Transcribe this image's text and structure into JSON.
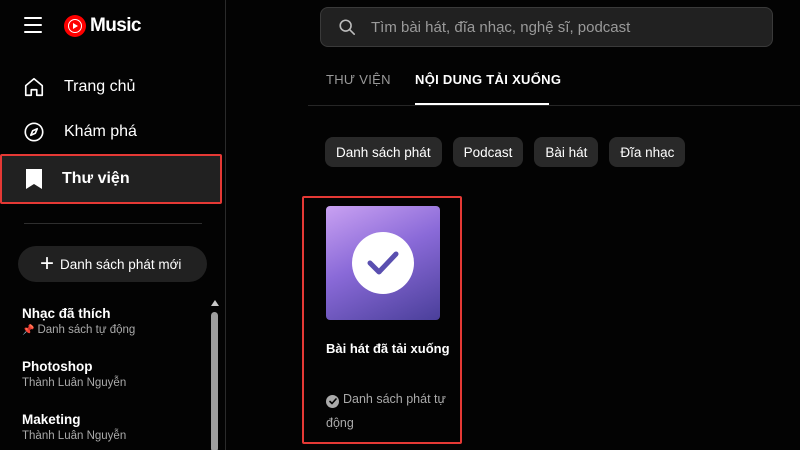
{
  "app": {
    "logo_text": "Music",
    "brand_color": "#ff0000"
  },
  "sidebar": {
    "nav": [
      {
        "label": "Trang chủ",
        "icon": "home-icon"
      },
      {
        "label": "Khám phá",
        "icon": "compass-icon"
      },
      {
        "label": "Thư viện",
        "icon": "bookmark-icon",
        "selected": true
      }
    ],
    "new_playlist_label": "Danh sách phát mới",
    "playlists": [
      {
        "title": "Nhạc đã thích",
        "subtitle": "Danh sách tự động",
        "pinned": true
      },
      {
        "title": "Photoshop",
        "subtitle": "Thành Luân Nguyễn"
      },
      {
        "title": "Maketing",
        "subtitle": "Thành Luân Nguyễn"
      }
    ]
  },
  "search": {
    "placeholder": "Tìm bài hát, đĩa nhạc, nghệ sĩ, podcast"
  },
  "tabs": [
    {
      "label": "THƯ VIỆN",
      "active": false
    },
    {
      "label": "NỘI DUNG TẢI XUỐNG",
      "active": true
    }
  ],
  "chips": [
    "Danh sách phát",
    "Podcast",
    "Bài hát",
    "Đĩa nhạc"
  ],
  "card": {
    "title": "Bài hát đã tải xuống",
    "subtitle": "Danh sách phát tự động"
  },
  "highlight_color": "#e53935"
}
